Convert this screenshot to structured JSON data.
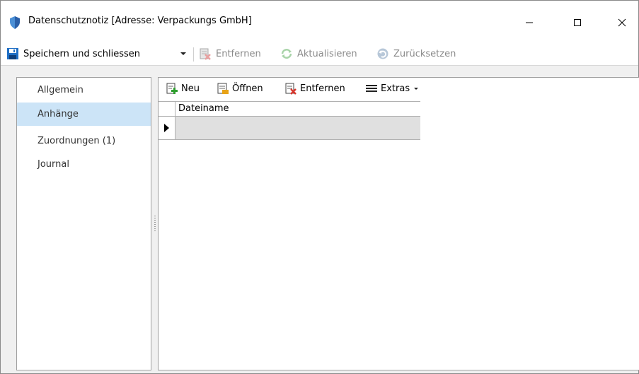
{
  "window": {
    "title": "Datenschutznotiz [Adresse: Verpackungs GmbH]",
    "controls": {
      "minimize": "—",
      "maximize": "☐",
      "close": "✕"
    }
  },
  "toolbar": {
    "save_label": "Speichern und schliessen",
    "remove_label": "Entfernen",
    "refresh_label": "Aktualisieren",
    "reset_label": "Zurücksetzen"
  },
  "nav": {
    "items": [
      {
        "label": "Allgemein",
        "selected": false
      },
      {
        "label": "Anhänge",
        "selected": true
      },
      {
        "label": "Zuordnungen  (1)",
        "selected": false
      },
      {
        "label": "Journal",
        "selected": false
      }
    ]
  },
  "attachments": {
    "toolbar": {
      "new_label": "Neu",
      "open_label": "Öffnen",
      "remove_label": "Entfernen",
      "extras_label": "Extras"
    },
    "table": {
      "columns": [
        "Dateiname"
      ],
      "rows": [
        [
          ""
        ]
      ]
    }
  },
  "colors": {
    "selected_nav": "#cce4f7",
    "disabled_text": "#8a8a8a",
    "save_icon": "#1f6fc5",
    "add_icon": "#2e9e2e",
    "remove_icon": "#d9352b"
  },
  "icons": {
    "title": "shield-icon",
    "save": "floppy-disk-icon",
    "dropdown": "chevron-down-icon",
    "remove": "delete-document-icon",
    "refresh": "refresh-icon",
    "reset": "undo-icon",
    "new": "add-document-icon",
    "open": "open-document-icon",
    "extras": "menu-icon",
    "row_indicator": "current-row-icon"
  }
}
